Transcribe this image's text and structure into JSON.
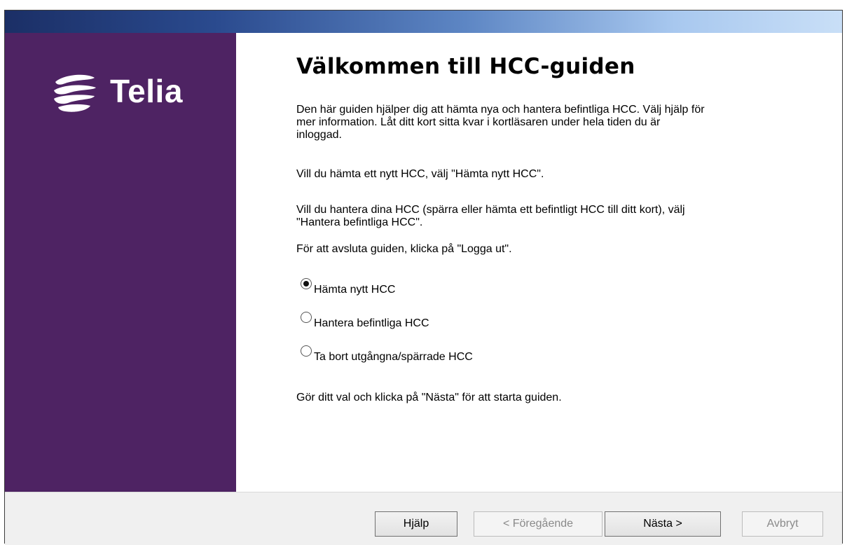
{
  "brand": {
    "name": "Telia",
    "color": "#4e2363"
  },
  "page": {
    "title": "Välkommen till HCC-guiden",
    "intro_line1": "Den här guiden hjälper dig att hämta nya och hantera befintliga HCC. Välj hjälp för",
    "intro_line2": "mer information. Låt ditt kort sitta kvar i kortläsaren under hela tiden du är",
    "intro_line3": "inloggad.",
    "info_fetch": "Vill du hämta ett nytt HCC, välj \"Hämta nytt HCC\".",
    "info_manage_line1": "Vill du hantera dina HCC (spärra eller hämta ett befintligt HCC till ditt kort), välj",
    "info_manage_line2": "\"Hantera befintliga HCC\".",
    "info_logout": "För att avsluta guiden, klicka på \"Logga ut\".",
    "instruction": "Gör ditt val och klicka på \"Nästa\" för att starta guiden."
  },
  "options": [
    {
      "label": "Hämta nytt HCC",
      "selected": true
    },
    {
      "label": "Hantera befintliga HCC",
      "selected": false
    },
    {
      "label": "Ta bort utgångna/spärrade HCC",
      "selected": false
    }
  ],
  "buttons": {
    "help": "Hjälp",
    "previous": "< Föregående",
    "next": "Nästa >",
    "cancel": "Avbryt"
  }
}
